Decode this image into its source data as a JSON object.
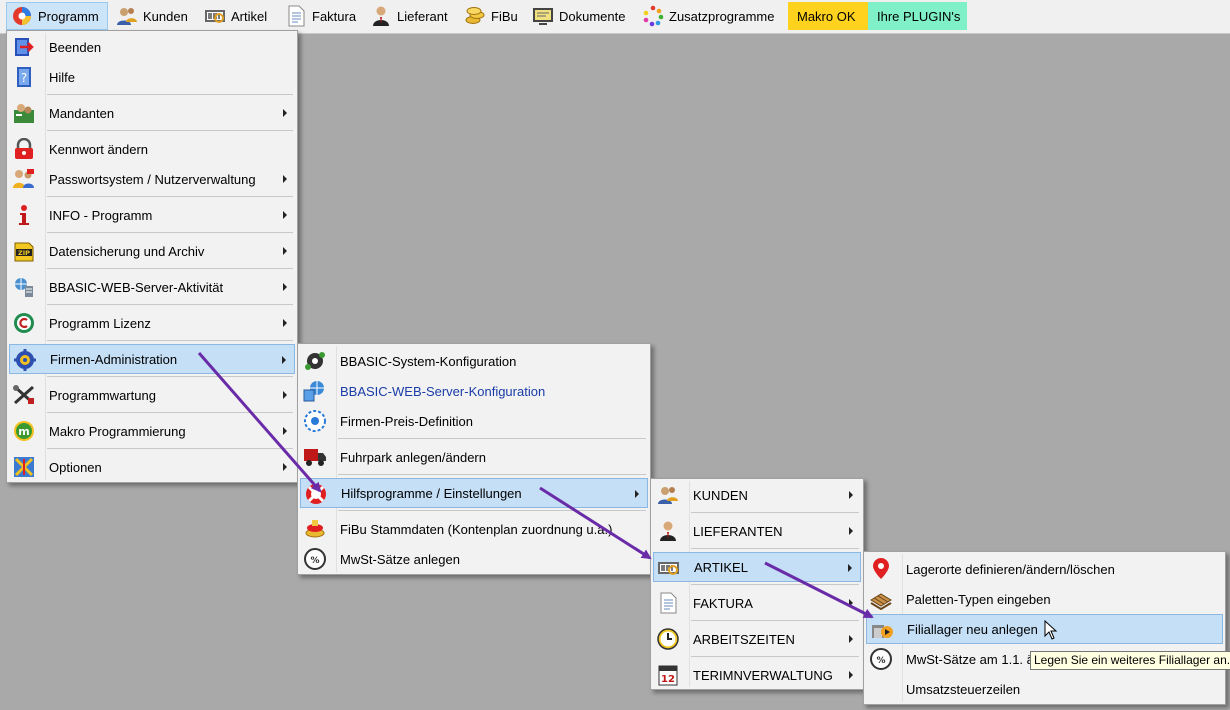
{
  "menubar": {
    "items": [
      {
        "label": "Programm",
        "icon": "programm-logo-icon"
      },
      {
        "label": "Kunden",
        "icon": "customers-icon"
      },
      {
        "label": "Artikel",
        "icon": "article-scanner-icon"
      },
      {
        "label": "Faktura",
        "icon": "invoice-document-icon"
      },
      {
        "label": "Lieferant",
        "icon": "supplier-person-icon"
      },
      {
        "label": "FiBu",
        "icon": "accounting-coins-icon"
      },
      {
        "label": "Dokumente",
        "icon": "documents-monitor-icon"
      },
      {
        "label": "Zusatzprogramme",
        "icon": "addon-programs-icon"
      }
    ],
    "makro": {
      "label": "Makro OK",
      "color": "#ffd21e"
    },
    "plugins": {
      "label": "Ihre PLUGIN's",
      "color": "#7ff0c8"
    }
  },
  "menu_programm": {
    "items": [
      {
        "label": "Beenden",
        "icon": "exit-icon"
      },
      {
        "label": "Hilfe",
        "icon": "help-book-icon"
      },
      {
        "label": "Mandanten",
        "icon": "clients-icon",
        "submenu": true
      },
      {
        "label": "Kennwort ändern",
        "icon": "password-lock-icon"
      },
      {
        "label": "Passwortsystem / Nutzerverwaltung",
        "icon": "user-management-icon",
        "submenu": true
      },
      {
        "label": "INFO - Programm",
        "icon": "info-icon",
        "submenu": true
      },
      {
        "label": "Datensicherung und Archiv",
        "icon": "zip-archive-icon",
        "submenu": true
      },
      {
        "label": "BBASIC-WEB-Server-Aktivität",
        "icon": "web-server-icon",
        "submenu": true
      },
      {
        "label": "Programm Lizenz",
        "icon": "copyright-license-icon",
        "submenu": true
      },
      {
        "label": "Firmen-Administration",
        "icon": "company-admin-gear-icon",
        "submenu": true,
        "highlighted": true
      },
      {
        "label": "Programmwartung",
        "icon": "maintenance-tools-icon",
        "submenu": true
      },
      {
        "label": "Makro Programmierung",
        "icon": "macro-m-icon",
        "submenu": true
      },
      {
        "label": "Optionen",
        "icon": "options-icon",
        "submenu": true
      }
    ]
  },
  "menu_firmen": {
    "items": [
      {
        "label": "BBASIC-System-Konfiguration",
        "icon": "system-config-gears-icon"
      },
      {
        "label": "BBASIC-WEB-Server-Konfiguration",
        "icon": "web-server-config-icon"
      },
      {
        "label": "Firmen-Preis-Definition",
        "icon": "price-definition-target-icon"
      },
      {
        "label": "Fuhrpark anlegen/ändern",
        "icon": "truck-icon"
      },
      {
        "label": "Hilfsprogramme / Einstellungen",
        "icon": "lifebuoy-icon",
        "submenu": true,
        "highlighted": true
      },
      {
        "label": "FiBu Stammdaten (Kontenplan zuordnung u.a.)",
        "icon": "accounting-master-data-icon"
      },
      {
        "label": "MwSt-Sätze anlegen",
        "icon": "vat-percent-icon"
      }
    ]
  },
  "menu_hilfs": {
    "items": [
      {
        "label": "KUNDEN",
        "icon": "customers-icon",
        "submenu": true
      },
      {
        "label": "LIEFERANTEN",
        "icon": "supplier-person-icon",
        "submenu": true
      },
      {
        "label": "ARTIKEL",
        "icon": "article-scanner-icon",
        "submenu": true,
        "highlighted": true
      },
      {
        "label": "FAKTURA",
        "icon": "invoice-document-icon",
        "submenu": true
      },
      {
        "label": "ARBEITSZEITEN",
        "icon": "clock-icon",
        "submenu": true
      },
      {
        "label": "TERIMNVERWALTUNG",
        "icon": "calendar-icon",
        "submenu": true
      }
    ]
  },
  "menu_artikel": {
    "items": [
      {
        "label": "Lagerorte definieren/ändern/löschen",
        "icon": "location-pin-icon"
      },
      {
        "label": "Paletten-Typen eingeben",
        "icon": "pallet-icon"
      },
      {
        "label": "Filiallager neu anlegen",
        "icon": "branch-warehouse-icon",
        "highlighted": true
      },
      {
        "label": "MwSt-Sätze am 1.1. ä",
        "icon": "vat-percent-icon"
      },
      {
        "label": "Umsatzsteuerzeilen",
        "icon": ""
      }
    ]
  },
  "tooltip": "Legen Sie ein weiteres Filiallager an.",
  "colors": {
    "arrow": "#6a2ba8",
    "highlight": "#c4dff6",
    "desktop": "#a9a9a9"
  }
}
